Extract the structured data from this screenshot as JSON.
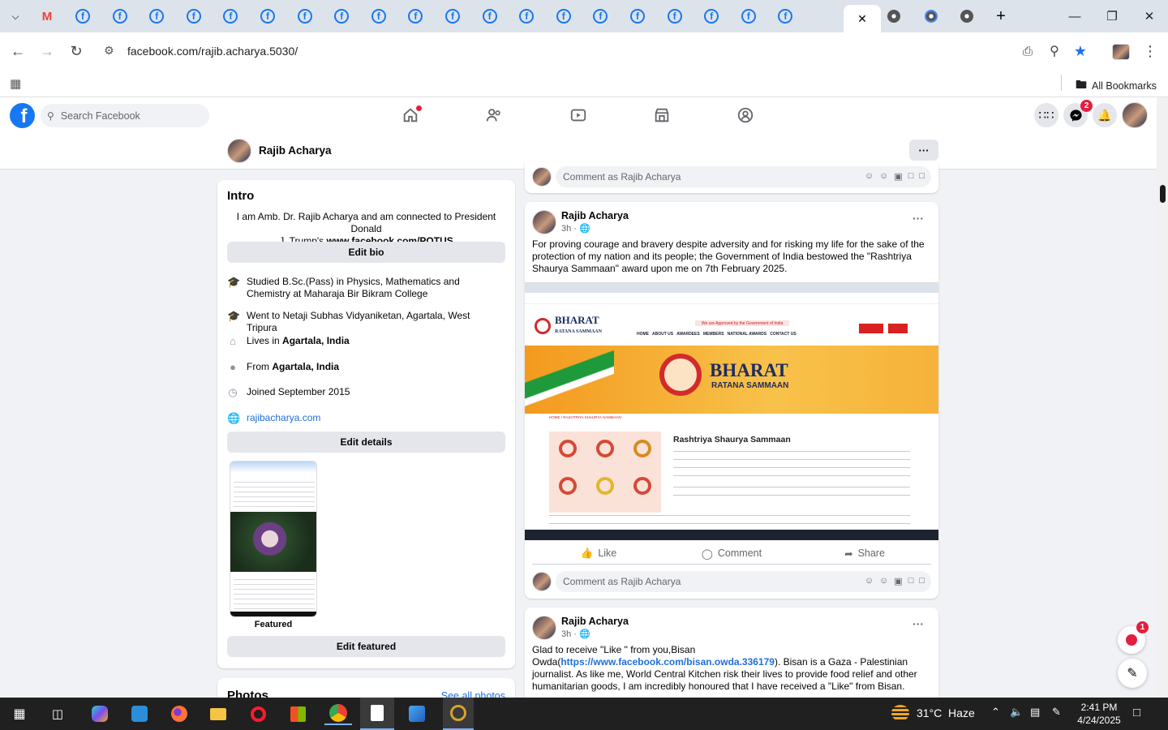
{
  "browser": {
    "url": "facebook.com/rajib.acharya.5030/",
    "bookmarks_label": "All Bookmarks",
    "tabs_fb_count": 20
  },
  "fb": {
    "logo": "f",
    "search_placeholder": "Search Facebook",
    "messenger_badge": "2",
    "profile_name": "Rajib Acharya",
    "more": "···"
  },
  "intro": {
    "title": "Intro",
    "bio_line1": "I am Amb. Dr. Rajib Acharya and am connected to President Donald",
    "bio_line2_pre": "J. Trump's ",
    "bio_link": "www.facebook.com/POTUS",
    "edit_bio": "Edit bio",
    "studied": "Studied B.Sc.(Pass) in Physics, Mathematics and Chemistry at Maharaja Bir Bikram College",
    "went_to": "Went to Netaji Subhas Vidyaniketan, Agartala, West Tripura",
    "lives_pre": "Lives in ",
    "lives_place": "Agartala, India",
    "from_pre": "From ",
    "from_place": "Agartala, India",
    "joined": "Joined September 2015",
    "website": "rajibacharya.com",
    "edit_details": "Edit details",
    "featured_label": "Featured",
    "edit_featured": "Edit featured",
    "photos_title": "Photos",
    "see_all_photos": "See all photos"
  },
  "posts": {
    "comment_placeholder": "Comment as Rajib Acharya",
    "like": "Like",
    "comment": "Comment",
    "share": "Share",
    "post1": {
      "author": "Rajib Acharya",
      "time": "3h · ",
      "text": "For proving courage and bravery despite adversity and for risking my life for the sake of  the protection of  my nation and its people; the Government of India bestowed the \"Rashtriya Shaurya Sammaan\" award upon me on 7th February 2025."
    },
    "post1_image": {
      "banner_title": "BHARAT",
      "banner_subtitle": "RATANA SAMMAAN",
      "notice": "We are Approved by the Government of India",
      "nav": "HOME   ABOUT US   AWARDEES   MEMBERS   NATIONAL AWARDS   CONTACT US",
      "heading": "Rashtriya Shaurya Sammaan",
      "breadcrumb": "HOME / RASHTRIYA SHAURYA SAMMAAN"
    },
    "post2": {
      "author": "Rajib Acharya",
      "time": "3h · ",
      "text_pre": "Glad to receive \"Like \" from you,Bisan Owda(",
      "link": "https://www.facebook.com/bisan.owda.336179",
      "text_post": "). Bisan is a Gaza - Palestinian journalist. As like me, World Central Kitchen risk their lives to provide food relief and other humanitarian goods, I am incredibly honoured that I have  received a \"Like\" from Bisan."
    },
    "news_badge": "1"
  },
  "taskbar": {
    "weather": "31°C  Haze",
    "time": "2:41 PM",
    "date": "4/24/2025"
  },
  "colors": {
    "fb_blue": "#1877f2",
    "link_blue": "#216fdb",
    "badge_red": "#e41e3f"
  }
}
